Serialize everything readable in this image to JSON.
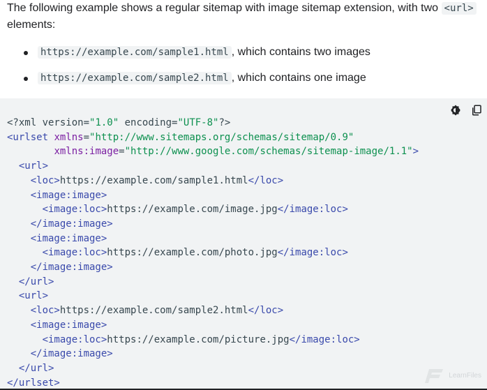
{
  "intro": {
    "text_before": "The following example shows a regular sitemap with image sitemap extension, with two ",
    "code": "<url>",
    "text_after": " elements:"
  },
  "bullets": [
    {
      "code": "https://example.com/sample1.html",
      "text": ", which contains two images"
    },
    {
      "code": "https://example.com/sample2.html",
      "text": ", which contains one image"
    }
  ],
  "code_block": {
    "lines": [
      [
        [
          "pi",
          "<?xml version="
        ],
        [
          "str",
          "\"1.0\""
        ],
        [
          "pi",
          " encoding="
        ],
        [
          "str",
          "\"UTF-8\""
        ],
        [
          "pi",
          "?>"
        ]
      ],
      [
        [
          "tag",
          "<urlset "
        ],
        [
          "attr",
          "xmlns"
        ],
        [
          "plain",
          "="
        ],
        [
          "str",
          "\"http://www.sitemaps.org/schemas/sitemap/0.9\""
        ]
      ],
      [
        [
          "plain",
          "        "
        ],
        [
          "attr",
          "xmlns:image"
        ],
        [
          "plain",
          "="
        ],
        [
          "str",
          "\"http://www.google.com/schemas/sitemap-image/1.1\""
        ],
        [
          "tag",
          ">"
        ]
      ],
      [
        [
          "plain",
          "  "
        ],
        [
          "tag",
          "<url>"
        ]
      ],
      [
        [
          "plain",
          "    "
        ],
        [
          "tag",
          "<loc>"
        ],
        [
          "plain",
          "https://example.com/sample1.html"
        ],
        [
          "tag",
          "</loc>"
        ]
      ],
      [
        [
          "plain",
          "    "
        ],
        [
          "tag",
          "<image:image>"
        ]
      ],
      [
        [
          "plain",
          "      "
        ],
        [
          "tag",
          "<image:loc>"
        ],
        [
          "plain",
          "https://example.com/image.jpg"
        ],
        [
          "tag",
          "</image:loc>"
        ]
      ],
      [
        [
          "plain",
          "    "
        ],
        [
          "tag",
          "</image:image>"
        ]
      ],
      [
        [
          "plain",
          "    "
        ],
        [
          "tag",
          "<image:image>"
        ]
      ],
      [
        [
          "plain",
          "      "
        ],
        [
          "tag",
          "<image:loc>"
        ],
        [
          "plain",
          "https://example.com/photo.jpg"
        ],
        [
          "tag",
          "</image:loc>"
        ]
      ],
      [
        [
          "plain",
          "    "
        ],
        [
          "tag",
          "</image:image>"
        ]
      ],
      [
        [
          "plain",
          "  "
        ],
        [
          "tag",
          "</url>"
        ]
      ],
      [
        [
          "plain",
          "  "
        ],
        [
          "tag",
          "<url>"
        ]
      ],
      [
        [
          "plain",
          "    "
        ],
        [
          "tag",
          "<loc>"
        ],
        [
          "plain",
          "https://example.com/sample2.html"
        ],
        [
          "tag",
          "</loc>"
        ]
      ],
      [
        [
          "plain",
          "    "
        ],
        [
          "tag",
          "<image:image>"
        ]
      ],
      [
        [
          "plain",
          "      "
        ],
        [
          "tag",
          "<image:loc>"
        ],
        [
          "plain",
          "https://example.com/picture.jpg"
        ],
        [
          "tag",
          "</image:loc>"
        ]
      ],
      [
        [
          "plain",
          "    "
        ],
        [
          "tag",
          "</image:image>"
        ]
      ],
      [
        [
          "plain",
          "  "
        ],
        [
          "tag",
          "</url>"
        ]
      ],
      [
        [
          "tag",
          "</urlset>"
        ]
      ]
    ]
  },
  "toolbar": {
    "theme_icon": "dark-mode-toggle-icon",
    "copy_icon": "copy-icon"
  },
  "watermark": {
    "text": "LearnFiles"
  },
  "colors": {
    "code_bg": "#f1f3f4",
    "tag": "#3949ab",
    "attr": "#7b1fa2",
    "string": "#0d904f",
    "text": "#37474f"
  }
}
